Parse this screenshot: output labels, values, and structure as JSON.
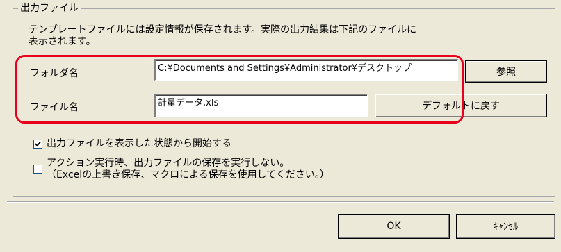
{
  "output_group": {
    "title": "出力ファイル",
    "description_line1": "テンプレートファイルには設定情報が保存されます。実際の出力結果は下記のファイルに",
    "description_line2": "表示されます。"
  },
  "folder": {
    "label": "フォルダ名",
    "value": "C:¥Documents and Settings¥Administrator¥デスクトップ",
    "browse_label": "参照"
  },
  "file": {
    "label": "ファイル名",
    "value": "計量データ.xls",
    "default_label": "デフォルトに戻す"
  },
  "options": {
    "show_output_label": "出力ファイルを表示した状態から開始する",
    "show_output_checked": true,
    "no_save_line1": "アクション実行時、出力ファイルの保存を実行しない。",
    "no_save_line2": "（Excelの上書き保存、マクロによる保存を使用してください。）",
    "no_save_checked": false
  },
  "footer": {
    "ok_label": "OK",
    "cancel_label": "ｷｬﾝｾﾙ"
  },
  "colors": {
    "dialog_bg": "#ece9d8",
    "highlight": "#e8001c"
  }
}
